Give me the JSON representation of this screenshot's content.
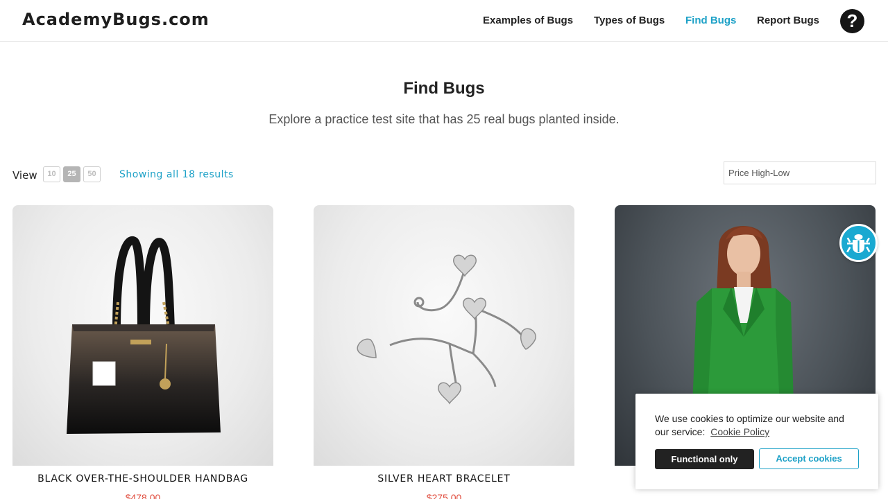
{
  "header": {
    "logo": "AcademyBugs.com",
    "nav": [
      "Examples of Bugs",
      "Types of Bugs",
      "Find Bugs",
      "Report Bugs"
    ],
    "active_nav": "Find Bugs",
    "help_icon": "question-circle-icon",
    "help_symbol": "?"
  },
  "hero": {
    "title": "Find Bugs",
    "subtitle": "Explore a practice test site that has 25 real bugs planted inside."
  },
  "toolbar": {
    "view_label": "View",
    "view_options": [
      "10",
      "25",
      "50"
    ],
    "view_selected": "25",
    "results_text": "Showing all 18 results",
    "sort_value": "Price High-Low"
  },
  "products": [
    {
      "name": "BLACK OVER-THE-SHOULDER HANDBAG",
      "price": "$478.00",
      "image": "black-handbag-image"
    },
    {
      "name": "SILVER HEART BRACELET",
      "price": "$275.00",
      "image": "silver-heart-bracelet-image"
    },
    {
      "name": "",
      "price": "",
      "image": "woman-green-suit-image"
    }
  ],
  "bug_button": {
    "icon": "bug-icon"
  },
  "cookie": {
    "text": "We use cookies to optimize our website and our service:",
    "link": "Cookie Policy",
    "functional": "Functional only",
    "accept": "Accept cookies"
  },
  "colors": {
    "accent": "#1da1c7",
    "price": "#e04b3c",
    "dark": "#222222"
  }
}
